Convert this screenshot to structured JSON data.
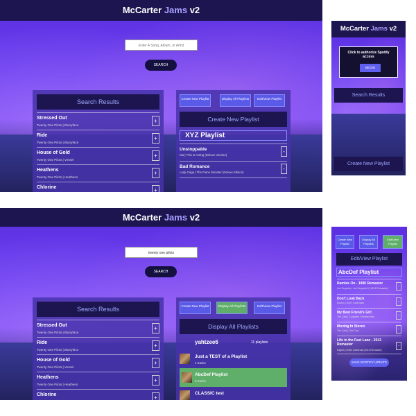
{
  "app": {
    "title_main": "McCarter",
    "title_accent": "Jams",
    "title_version": "v2"
  },
  "search": {
    "placeholder": "Enter A Song, Album, or Artist",
    "query": "twenty one pilots",
    "button": "SEARCH"
  },
  "results": {
    "title": "Search Results",
    "plus": "+",
    "songs": [
      {
        "title": "Stressed Out",
        "sub": "Twenty One Pilots | Blurryface"
      },
      {
        "title": "Ride",
        "sub": "Twenty One Pilots | Blurryface"
      },
      {
        "title": "House of Gold",
        "sub": "Twenty One Pilots | Vessel"
      },
      {
        "title": "Heathens",
        "sub": "Twenty One Pilots | Heathens"
      },
      {
        "title": "Chlorine",
        "sub": ""
      }
    ]
  },
  "tabs": {
    "create": "Create New Playlist",
    "display": "Display All Playlists",
    "edit": "Edit/View Playlist"
  },
  "create": {
    "title": "Create New Playlist",
    "playlist_name": "XYZ Playlist",
    "minus": "-",
    "songs": [
      {
        "title": "Unstoppable",
        "sub": "Sia | This Is Acting (Deluxe Version)"
      },
      {
        "title": "Bad Romance",
        "sub": "Lady Gaga | The Fame Monster (Deluxe Edition)"
      }
    ]
  },
  "display": {
    "title": "Display All Playlists",
    "user": "yahtzee6",
    "count": "11 playlists",
    "playlists": [
      {
        "name": "Just a TEST of a Playlist",
        "tracks": "1 tracks"
      },
      {
        "name": "AbcDef Playlist",
        "tracks": "5 tracks"
      },
      {
        "name": "CLASSIC test",
        "tracks": ""
      }
    ]
  },
  "auth": {
    "text": "Click to authorize Spotify access",
    "button": "BEGIN"
  },
  "edit": {
    "title": "Edit/View Playlist",
    "playlist_name": "AbcDef Playlist",
    "save": "SAVE SPOTIFY UPDATE",
    "songs": [
      {
        "title": "Ramble On - 1990 Remaster",
        "sub": "Led Zeppelin | Led Zeppelin II (1994 Remaster)"
      },
      {
        "title": "Don't Look Back",
        "sub": "Boston | Don't Look Back"
      },
      {
        "title": "My Best Friend's Girl",
        "sub": "The Cars | Complete Greatest Hits"
      },
      {
        "title": "Moving In Stereo",
        "sub": "The Cars | The Cars"
      },
      {
        "title": "Life in the Fast Lane - 2013 Remaster",
        "sub": "Eagles | Hotel California (2013 Remaster)"
      }
    ]
  },
  "colors": {
    "header": "#1c1550",
    "accent": "#a8a0ff",
    "active_tab": "#5fae6a",
    "button": "#6060f0"
  }
}
